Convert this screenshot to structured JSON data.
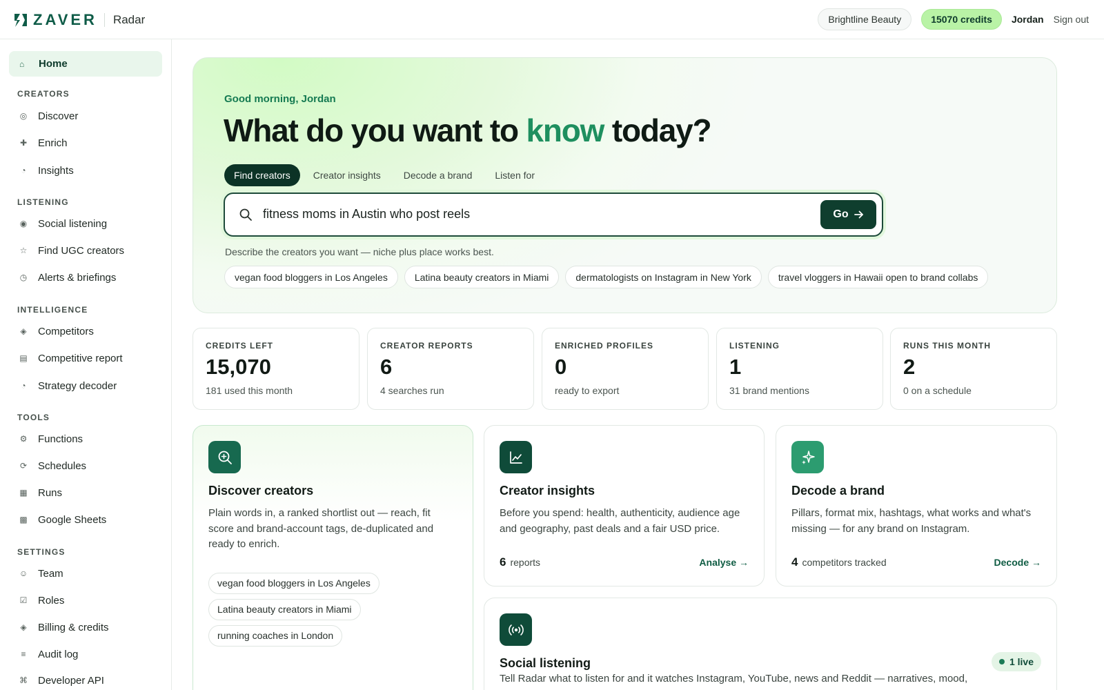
{
  "brand": {
    "logo_text": "ZAVER",
    "product": "Radar"
  },
  "topbar": {
    "org": "Brightline Beauty",
    "credits": "15070 credits",
    "user": "Jordan",
    "signout": "Sign out"
  },
  "sidebar": {
    "home": {
      "label": "Home",
      "icon": "home-icon"
    },
    "sections": [
      {
        "title": "CREATORS",
        "items": [
          {
            "label": "Discover",
            "icon": "ring-icon"
          },
          {
            "label": "Enrich",
            "icon": "plus-icon"
          },
          {
            "label": "Insights",
            "icon": "pie-icon"
          }
        ]
      },
      {
        "title": "LISTENING",
        "items": [
          {
            "label": "Social listening",
            "icon": "radio-icon"
          },
          {
            "label": "Find UGC creators",
            "icon": "star-icon"
          },
          {
            "label": "Alerts & briefings",
            "icon": "clock-icon"
          }
        ]
      },
      {
        "title": "INTELLIGENCE",
        "items": [
          {
            "label": "Competitors",
            "icon": "diamond-icon"
          },
          {
            "label": "Competitive report",
            "icon": "report-icon"
          },
          {
            "label": "Strategy decoder",
            "icon": "pie-icon"
          }
        ]
      },
      {
        "title": "TOOLS",
        "items": [
          {
            "label": "Functions",
            "icon": "gear-icon"
          },
          {
            "label": "Schedules",
            "icon": "cycle-icon"
          },
          {
            "label": "Runs",
            "icon": "square-icon"
          },
          {
            "label": "Google Sheets",
            "icon": "sheet-icon"
          }
        ]
      },
      {
        "title": "SETTINGS",
        "items": [
          {
            "label": "Team",
            "icon": "smile-icon"
          },
          {
            "label": "Roles",
            "icon": "check-box-icon"
          },
          {
            "label": "Billing & credits",
            "icon": "diamond-icon"
          },
          {
            "label": "Audit log",
            "icon": "lines-icon"
          },
          {
            "label": "Developer API",
            "icon": "command-icon"
          }
        ]
      }
    ]
  },
  "hero": {
    "greeting": "Good morning, Jordan",
    "headline_pre": "What do you want to ",
    "headline_accent": "know",
    "headline_post": " today?",
    "tabs": [
      "Find creators",
      "Creator insights",
      "Decode a brand",
      "Listen for"
    ],
    "active_tab": "Find creators",
    "search_value": "fitness moms in Austin who post reels",
    "go_label": "Go",
    "hint": "Describe the creators you want — niche plus place works best.",
    "suggestions": [
      "vegan food bloggers in Los Angeles",
      "Latina beauty creators in Miami",
      "dermatologists on Instagram in New York",
      "travel vloggers in Hawaii open to brand collabs"
    ]
  },
  "stats": [
    {
      "label": "CREDITS LEFT",
      "value": "15,070",
      "sub": "181 used this month"
    },
    {
      "label": "CREATOR REPORTS",
      "value": "6",
      "sub": "4 searches run"
    },
    {
      "label": "ENRICHED PROFILES",
      "value": "0",
      "sub": "ready to export"
    },
    {
      "label": "LISTENING",
      "value": "1",
      "sub": "31 brand mentions"
    },
    {
      "label": "RUNS THIS MONTH",
      "value": "2",
      "sub": "0 on a schedule"
    }
  ],
  "cards": {
    "discover": {
      "title": "Discover creators",
      "desc_lines": [
        "Plain words in, a ranked shortlist out — reach, fit",
        "score and brand-account tags, de-duplicated and",
        "ready to enrich."
      ],
      "chips": [
        "vegan food bloggers in Los Angeles",
        "Latina beauty creators in Miami",
        "running coaches in London"
      ]
    },
    "insights": {
      "title": "Creator insights",
      "desc_lines": [
        "Before you spend: health, authenticity, audience age",
        "and geography, past deals and a fair USD price."
      ],
      "count": "6",
      "count_label": "reports",
      "link": "Analyse →"
    },
    "decode": {
      "title": "Decode a brand",
      "desc_lines": [
        "Pillars, format mix, hashtags, what works and what's",
        "missing — for any brand on Instagram."
      ],
      "count": "4",
      "count_label": "competitors tracked",
      "link": "Decode →"
    },
    "listening": {
      "title": "Social listening",
      "badge": "1 live",
      "desc": "Tell Radar what to listen for and it watches Instagram, YouTube, news and Reddit — narratives, mood,"
    }
  },
  "colors": {
    "brand_dark": "#0f3e2e",
    "accent_green": "#1e8f5f",
    "credits_pill": "#b9f3a6"
  }
}
